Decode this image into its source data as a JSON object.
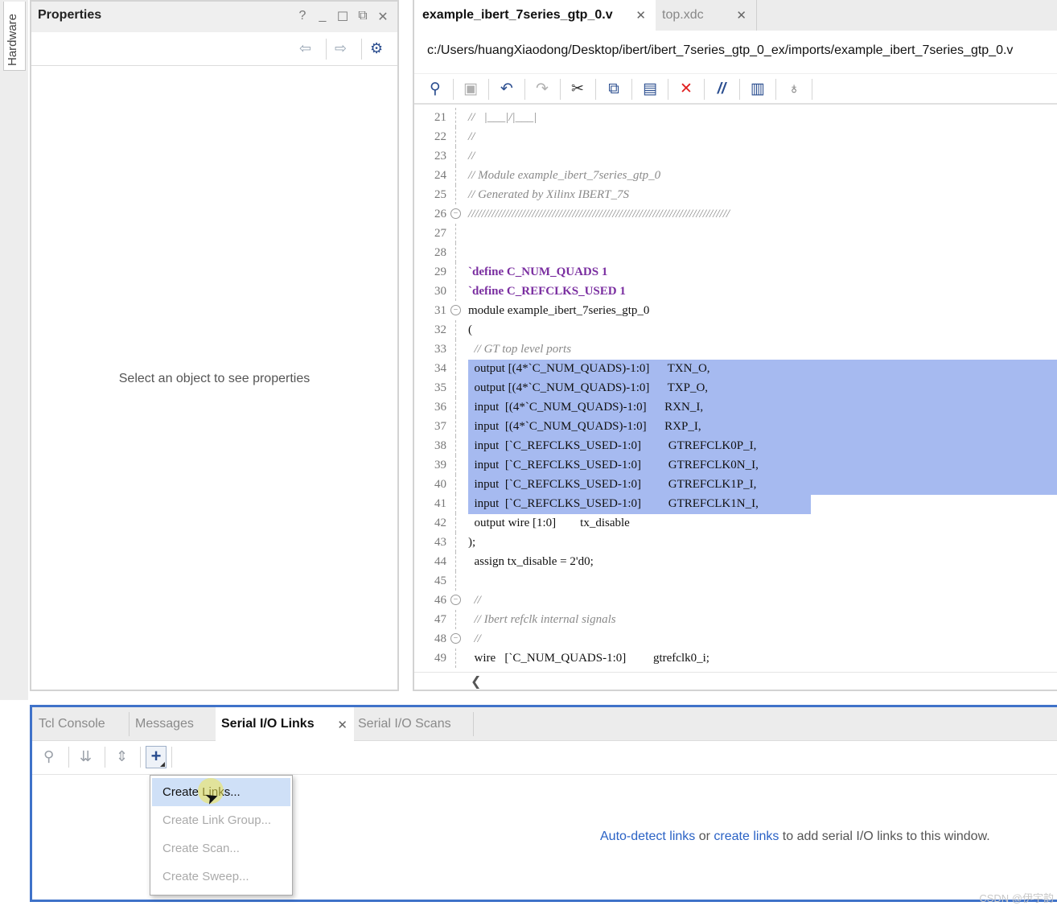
{
  "side_tab": {
    "label": "Hardware"
  },
  "properties": {
    "title": "Properties",
    "header_icons": [
      "help-icon",
      "minimize-icon",
      "maximize-icon",
      "float-icon",
      "close-icon"
    ],
    "empty_message": "Select an object to see properties"
  },
  "editor": {
    "tabs": [
      {
        "label": "example_ibert_7series_gtp_0.v",
        "active": true
      },
      {
        "label": "top.xdc",
        "active": false
      }
    ],
    "file_path": "c:/Users/huangXiaodong/Desktop/ibert/ibert_7series_gtp_0_ex/imports/example_ibert_7series_gtp_0.v",
    "toolbar_icons": [
      "search-icon",
      "save-icon",
      "undo-icon",
      "redo-icon",
      "cut-icon",
      "copy-icon",
      "paste-icon",
      "delete-icon",
      "comment-icon",
      "columns-icon",
      "bulb-icon"
    ],
    "highlight_color": "#a6baf0",
    "lines": [
      {
        "n": "21",
        "text": "//   |___|/|___|"
      },
      {
        "n": "22",
        "text": "//"
      },
      {
        "n": "23",
        "text": "//"
      },
      {
        "n": "24",
        "text": "// Module example_ibert_7series_gtp_0"
      },
      {
        "n": "25",
        "text": "// Generated by Xilinx IBERT_7S"
      },
      {
        "n": "26",
        "text": "//////////////////////////////////////////////////////////////////////////////"
      },
      {
        "n": "27",
        "text": ""
      },
      {
        "n": "28",
        "text": ""
      },
      {
        "n": "29",
        "text": "`define C_NUM_QUADS 1"
      },
      {
        "n": "30",
        "text": "`define C_REFCLKS_USED 1"
      },
      {
        "n": "31",
        "text": "module example_ibert_7series_gtp_0"
      },
      {
        "n": "32",
        "text": "("
      },
      {
        "n": "33",
        "text": "  // GT top level ports"
      },
      {
        "n": "34",
        "text": "  output [(4*`C_NUM_QUADS)-1:0]      TXN_O,"
      },
      {
        "n": "35",
        "text": "  output [(4*`C_NUM_QUADS)-1:0]      TXP_O,"
      },
      {
        "n": "36",
        "text": "  input  [(4*`C_NUM_QUADS)-1:0]      RXN_I,"
      },
      {
        "n": "37",
        "text": "  input  [(4*`C_NUM_QUADS)-1:0]      RXP_I,"
      },
      {
        "n": "38",
        "text": "  input  [`C_REFCLKS_USED-1:0]         GTREFCLK0P_I,"
      },
      {
        "n": "39",
        "text": "  input  [`C_REFCLKS_USED-1:0]         GTREFCLK0N_I,"
      },
      {
        "n": "40",
        "text": "  input  [`C_REFCLKS_USED-1:0]         GTREFCLK1P_I,"
      },
      {
        "n": "41",
        "text": "  input  [`C_REFCLKS_USED-1:0]         GTREFCLK1N_I,"
      },
      {
        "n": "42",
        "text": "  output wire [1:0]        tx_disable"
      },
      {
        "n": "43",
        "text": ");"
      },
      {
        "n": "44",
        "text": "  assign tx_disable = 2'd0;"
      },
      {
        "n": "45",
        "text": ""
      },
      {
        "n": "46",
        "text": "  //"
      },
      {
        "n": "47",
        "text": "  // Ibert refclk internal signals"
      },
      {
        "n": "48",
        "text": "  //"
      },
      {
        "n": "49",
        "text": "  wire   [`C_NUM_QUADS-1:0]         gtrefclk0_i;"
      }
    ]
  },
  "bottom": {
    "tabs": [
      {
        "label": "Tcl Console",
        "active": false
      },
      {
        "label": "Messages",
        "active": false
      },
      {
        "label": "Serial I/O Links",
        "active": true
      },
      {
        "label": "Serial I/O Scans",
        "active": false
      }
    ],
    "toolbar_icons": [
      "search-icon",
      "collapse-all-icon",
      "expand-all-icon",
      "add-icon"
    ],
    "menu": [
      {
        "label": "Create Links...",
        "enabled": true
      },
      {
        "label": "Create Link Group...",
        "enabled": false
      },
      {
        "label": "Create Scan...",
        "enabled": false
      },
      {
        "label": "Create Sweep...",
        "enabled": false
      }
    ],
    "message": {
      "link1": "Auto-detect links",
      "mid": "or",
      "link2": "create links",
      "rest": "to add serial I/O links to this window."
    }
  },
  "watermark": "CSDN @伊宇韵"
}
